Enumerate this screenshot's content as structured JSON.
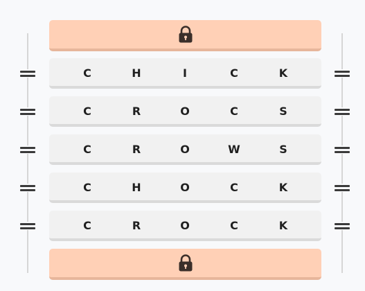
{
  "top_lock": {
    "icon": "lock-icon"
  },
  "bottom_lock": {
    "icon": "lock-icon"
  },
  "words": [
    {
      "letters": [
        "C",
        "H",
        "I",
        "C",
        "K"
      ]
    },
    {
      "letters": [
        "C",
        "R",
        "O",
        "C",
        "S"
      ]
    },
    {
      "letters": [
        "C",
        "R",
        "O",
        "W",
        "S"
      ]
    },
    {
      "letters": [
        "C",
        "H",
        "O",
        "C",
        "K"
      ]
    },
    {
      "letters": [
        "C",
        "R",
        "O",
        "C",
        "K"
      ]
    }
  ],
  "colors": {
    "lock_tile": "#ffd0b6",
    "word_tile": "#f1f1f1",
    "text": "#1f1f1f"
  }
}
